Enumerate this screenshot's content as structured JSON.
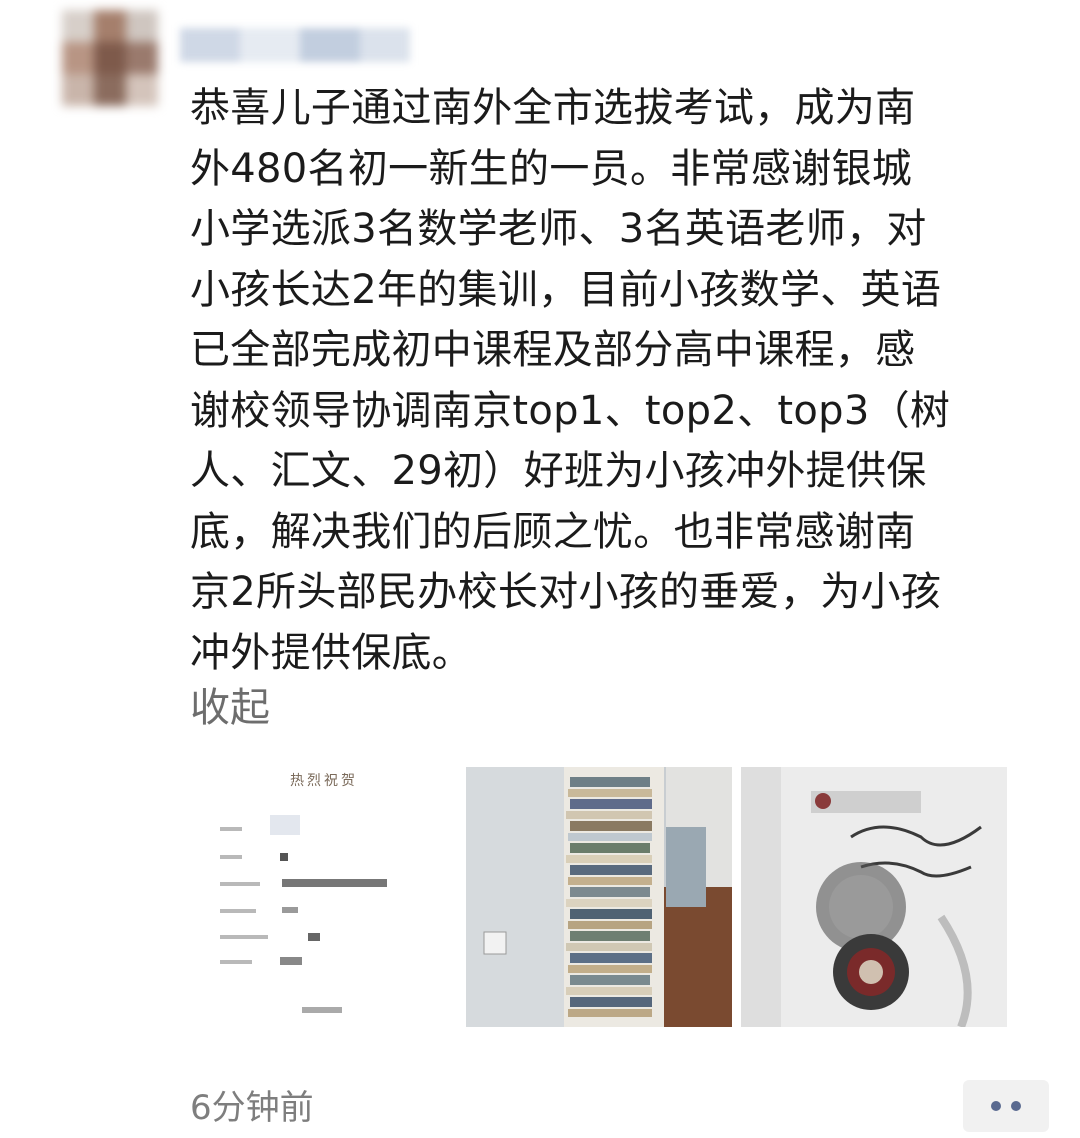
{
  "post": {
    "text_lines": [
      "恭喜儿子通过南外全市选拔考试，成为南",
      "外480名初一新生的一员。非常感谢银城",
      "小学选派3名数学老师、3名英语老师，对",
      "小孩长达2年的集训，目前小孩数学、英语",
      "已全部完成初中课程及部分高中课程，感",
      "谢校领导协调南京top1、top2、top3（树",
      "人、汇文、29初）好班为小孩冲外提供保",
      "底，解决我们的后顾之忧。也非常感谢南",
      "京2所头部民办校长对小孩的垂爱，为小孩",
      "冲外提供保底。"
    ],
    "collapse_label": "收起",
    "timestamp": "6分钟前"
  },
  "photos": {
    "photo1_heading": "热烈祝贺"
  },
  "colors": {
    "text": "#1b1b1b",
    "muted": "#6d6d6d",
    "more_dots": "#5a6a90",
    "more_bg": "#f1f1f1"
  }
}
